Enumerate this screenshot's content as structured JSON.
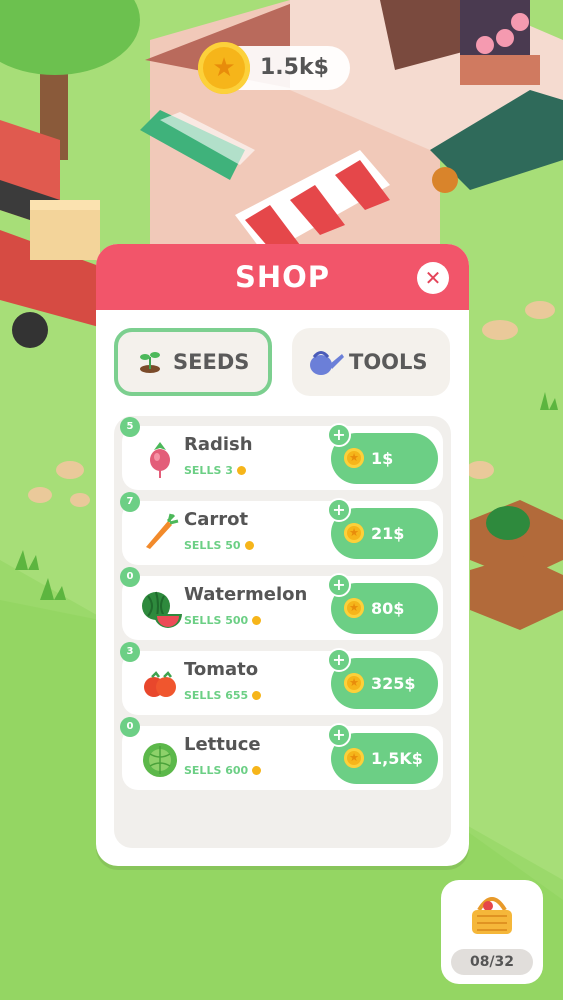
{
  "hud": {
    "coins": "1.5k$"
  },
  "shop": {
    "title": "SHOP",
    "tabs": [
      {
        "label": "SEEDS",
        "icon": "sprout-icon",
        "active": true
      },
      {
        "label": "TOOLS",
        "icon": "watering-can-icon",
        "active": false
      }
    ],
    "items": [
      {
        "name": "Radish",
        "count": "5",
        "sells": "SELLS 3",
        "price": "1$",
        "icon": "radish-icon"
      },
      {
        "name": "Carrot",
        "count": "7",
        "sells": "SELLS 50",
        "price": "21$",
        "icon": "carrot-icon"
      },
      {
        "name": "Watermelon",
        "count": "0",
        "sells": "SELLS 500",
        "price": "80$",
        "icon": "watermelon-icon"
      },
      {
        "name": "Tomato",
        "count": "3",
        "sells": "SELLS 655",
        "price": "325$",
        "icon": "tomato-icon"
      },
      {
        "name": "Lettuce",
        "count": "0",
        "sells": "SELLS 600",
        "price": "1,5K$",
        "icon": "lettuce-icon"
      }
    ]
  },
  "basket": {
    "count": "08/32"
  },
  "colors": {
    "header": "#f2556a",
    "accent_green": "#6ccf85",
    "coin": "#f6b51a",
    "grass": "#a4dc74"
  }
}
